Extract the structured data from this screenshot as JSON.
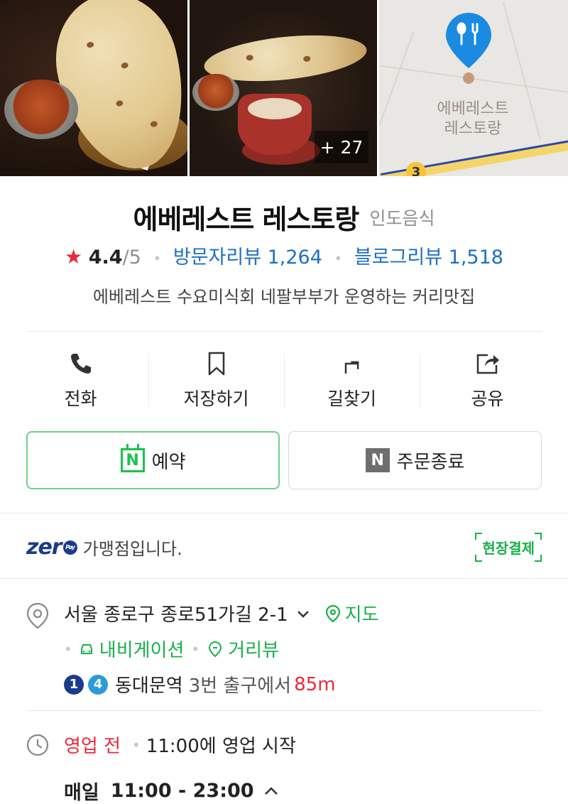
{
  "photos": {
    "more_count": "+ 27",
    "map_label_line1": "에베레스트",
    "map_label_line2": "레스토랑",
    "map_badge": "3",
    "pin_color": "#1a8be0"
  },
  "place": {
    "name": "에베레스트 레스토랑",
    "category": "인도음식",
    "rating": "4.4",
    "rating_max": "/5",
    "visitor_review_label": "방문자리뷰 1,264",
    "blog_review_label": "블로그리뷰 1,518",
    "description": "에베레스트 수요미식회 네팔부부가 운영하는 커리맛집"
  },
  "actions": [
    {
      "label": "전화",
      "icon": "phone-icon"
    },
    {
      "label": "저장하기",
      "icon": "bookmark-icon"
    },
    {
      "label": "길찾기",
      "icon": "directions-icon"
    },
    {
      "label": "공유",
      "icon": "share-icon"
    }
  ],
  "booking": {
    "reserve_label": "예약",
    "order_label": "주문종료",
    "n_letter": "N"
  },
  "zeropay": {
    "logo": "zer",
    "logo_pay": "Pay",
    "text": "가맹점입니다.",
    "onsite_label": "현장결제"
  },
  "address": {
    "text": "서울 종로구 종로51가길 2-1",
    "map_label": "지도",
    "navigation_label": "내비게이션",
    "streetview_label": "거리뷰",
    "subway_lines": [
      "1",
      "4"
    ],
    "station": "동대문역",
    "exit": "3번 출구에서",
    "distance": "85m"
  },
  "hours": {
    "status": "영업 전",
    "open_text": "11:00에 영업 시작",
    "daily_label": "매일",
    "daily_time": "11:00 - 23:00"
  },
  "colors": {
    "accent_green": "#19b04a",
    "link_blue": "#1e6fc2",
    "star_red": "#e8293b"
  }
}
